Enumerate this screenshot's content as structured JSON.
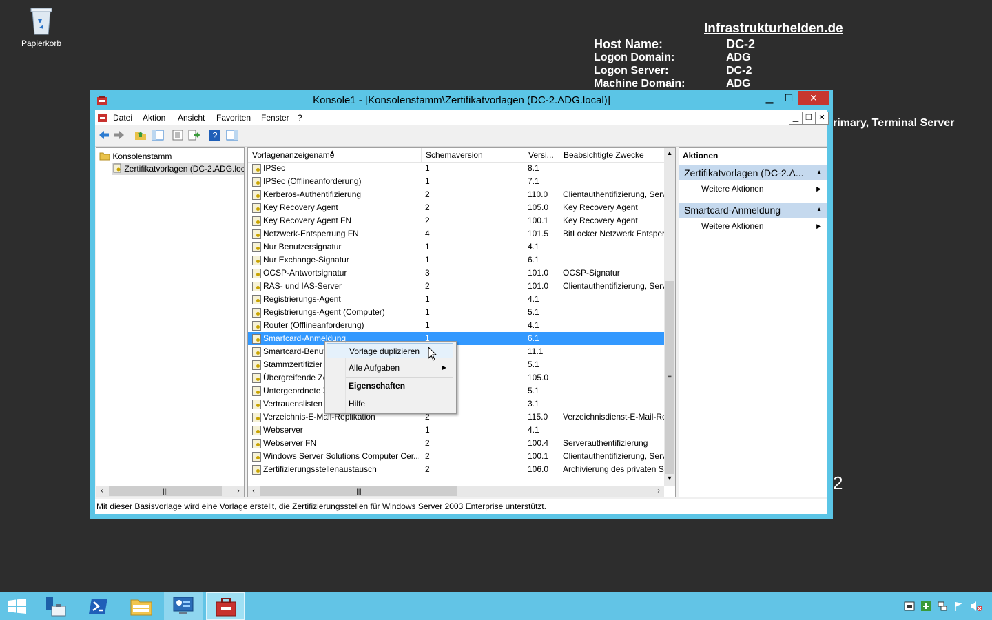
{
  "desktop": {
    "recycle_bin_label": "Papierkorb",
    "bginfo": {
      "title": "Infrastrukturhelden.de",
      "rows": [
        {
          "label": "Host Name:",
          "value": "DC-2"
        },
        {
          "label": "Logon Domain:",
          "value": "ADG"
        },
        {
          "label": "Logon Server:",
          "value": "DC-2"
        },
        {
          "label": "Machine Domain:",
          "value": "ADG"
        }
      ],
      "partial_line": "rimary, Terminal Server",
      "partial_digit": "2"
    }
  },
  "window": {
    "title": "Konsole1 - [Konsolenstamm\\Zertifikatvorlagen (DC-2.ADG.local)]",
    "menu": [
      "Datei",
      "Aktion",
      "Ansicht",
      "Favoriten",
      "Fenster",
      "?"
    ]
  },
  "tree": {
    "root": "Konsolenstamm",
    "child": "Zertifikatvorlagen (DC-2.ADG.local)"
  },
  "list": {
    "columns": [
      "Vorlagenanzeigename",
      "Schemaversion",
      "Versi...",
      "Beabsichtigte Zwecke"
    ],
    "rows": [
      {
        "name": "IPSec",
        "schema": "1",
        "version": "8.1",
        "purpose": ""
      },
      {
        "name": "IPSec (Offlineanforderung)",
        "schema": "1",
        "version": "7.1",
        "purpose": ""
      },
      {
        "name": "Kerberos-Authentifizierung",
        "schema": "2",
        "version": "110.0",
        "purpose": "Clientauthentifizierung, Serv"
      },
      {
        "name": "Key Recovery Agent",
        "schema": "2",
        "version": "105.0",
        "purpose": "Key Recovery Agent"
      },
      {
        "name": "Key Recovery Agent FN",
        "schema": "2",
        "version": "100.1",
        "purpose": "Key Recovery Agent"
      },
      {
        "name": "Netzwerk-Entsperrung FN",
        "schema": "4",
        "version": "101.5",
        "purpose": "BitLocker Netzwerk Entsperr"
      },
      {
        "name": "Nur Benutzersignatur",
        "schema": "1",
        "version": "4.1",
        "purpose": ""
      },
      {
        "name": "Nur Exchange-Signatur",
        "schema": "1",
        "version": "6.1",
        "purpose": ""
      },
      {
        "name": "OCSP-Antwortsignatur",
        "schema": "3",
        "version": "101.0",
        "purpose": "OCSP-Signatur"
      },
      {
        "name": "RAS- und IAS-Server",
        "schema": "2",
        "version": "101.0",
        "purpose": "Clientauthentifizierung, Serv"
      },
      {
        "name": "Registrierungs-Agent",
        "schema": "1",
        "version": "4.1",
        "purpose": ""
      },
      {
        "name": "Registrierungs-Agent (Computer)",
        "schema": "1",
        "version": "5.1",
        "purpose": ""
      },
      {
        "name": "Router (Offlineanforderung)",
        "schema": "1",
        "version": "4.1",
        "purpose": ""
      },
      {
        "name": "Smartcard-Anmeldung",
        "schema": "1",
        "version": "6.1",
        "purpose": ""
      },
      {
        "name": "Smartcard-Benut",
        "schema": "",
        "version": "11.1",
        "purpose": ""
      },
      {
        "name": "Stammzertifizier",
        "schema": "",
        "version": "5.1",
        "purpose": ""
      },
      {
        "name": "Übergreifende Ze",
        "schema": "",
        "version": "105.0",
        "purpose": ""
      },
      {
        "name": "Untergeordnete Z",
        "schema": "",
        "version": "5.1",
        "purpose": ""
      },
      {
        "name": "Vertrauenslisten",
        "schema": "",
        "version": "3.1",
        "purpose": ""
      },
      {
        "name": "Verzeichnis-E-Mail-Replikation",
        "schema": "2",
        "version": "115.0",
        "purpose": "Verzeichnisdienst-E-Mail-Re"
      },
      {
        "name": "Webserver",
        "schema": "1",
        "version": "4.1",
        "purpose": ""
      },
      {
        "name": "Webserver FN",
        "schema": "2",
        "version": "100.4",
        "purpose": "Serverauthentifizierung"
      },
      {
        "name": "Windows Server Solutions Computer Cer...",
        "schema": "2",
        "version": "100.1",
        "purpose": "Clientauthentifizierung, Serv"
      },
      {
        "name": "Zertifizierungsstellenaustausch",
        "schema": "2",
        "version": "106.0",
        "purpose": "Archivierung des privaten Sc"
      }
    ],
    "selected_index": 13
  },
  "context_menu": {
    "items": [
      "Vorlage duplizieren",
      "Alle Aufgaben",
      "Eigenschaften",
      "Hilfe"
    ]
  },
  "actions": {
    "header": "Aktionen",
    "groups": [
      {
        "title": "Zertifikatvorlagen (DC-2.A...",
        "item": "Weitere Aktionen"
      },
      {
        "title": "Smartcard-Anmeldung",
        "item": "Weitere Aktionen"
      }
    ]
  },
  "status": "Mit dieser Basisvorlage wird eine Vorlage erstellt, die Zertifizierungsstellen für Windows Server 2003 Enterprise unterstützt.",
  "colors": {
    "accent": "#5bc5e6",
    "selection": "#3399ff",
    "taskbar": "#62c4e6",
    "desktop": "#2d2d2d"
  }
}
